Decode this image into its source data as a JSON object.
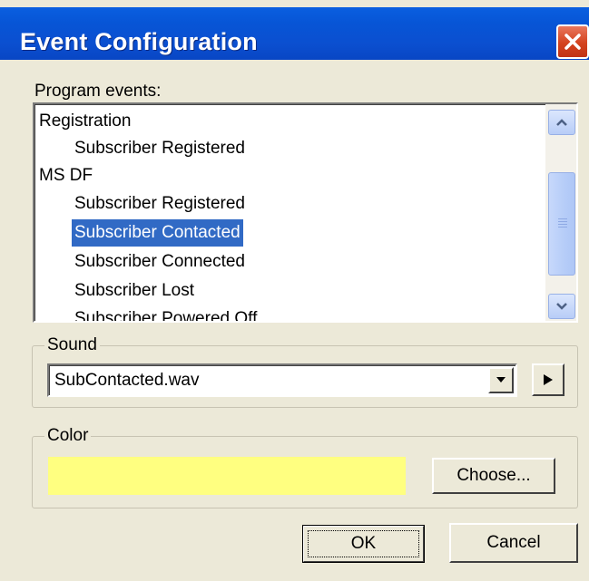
{
  "window": {
    "title": "Event Configuration"
  },
  "events": {
    "label": "Program events:",
    "items": [
      {
        "label": "Registration",
        "level": "group"
      },
      {
        "label": "Subscriber Registered",
        "level": "child"
      },
      {
        "label": "MS DF",
        "level": "group"
      },
      {
        "label": "Subscriber Registered",
        "level": "child"
      },
      {
        "label": "Subscriber Contacted",
        "level": "child",
        "selected": true
      },
      {
        "label": "Subscriber Connected",
        "level": "child"
      },
      {
        "label": "Subscriber Lost",
        "level": "child"
      },
      {
        "label": "Subscriber Powered Off",
        "level": "child"
      }
    ]
  },
  "sound": {
    "label": "Sound",
    "value": "SubContacted.wav"
  },
  "color": {
    "label": "Color",
    "swatch": "#ffff80",
    "choose_label": "Choose..."
  },
  "buttons": {
    "ok": "OK",
    "cancel": "Cancel"
  },
  "icons": {
    "close": "close-icon",
    "scroll_up": "chevron-up-icon",
    "scroll_down": "chevron-down-icon",
    "dropdown": "dropdown-arrow-icon",
    "play": "play-icon"
  }
}
